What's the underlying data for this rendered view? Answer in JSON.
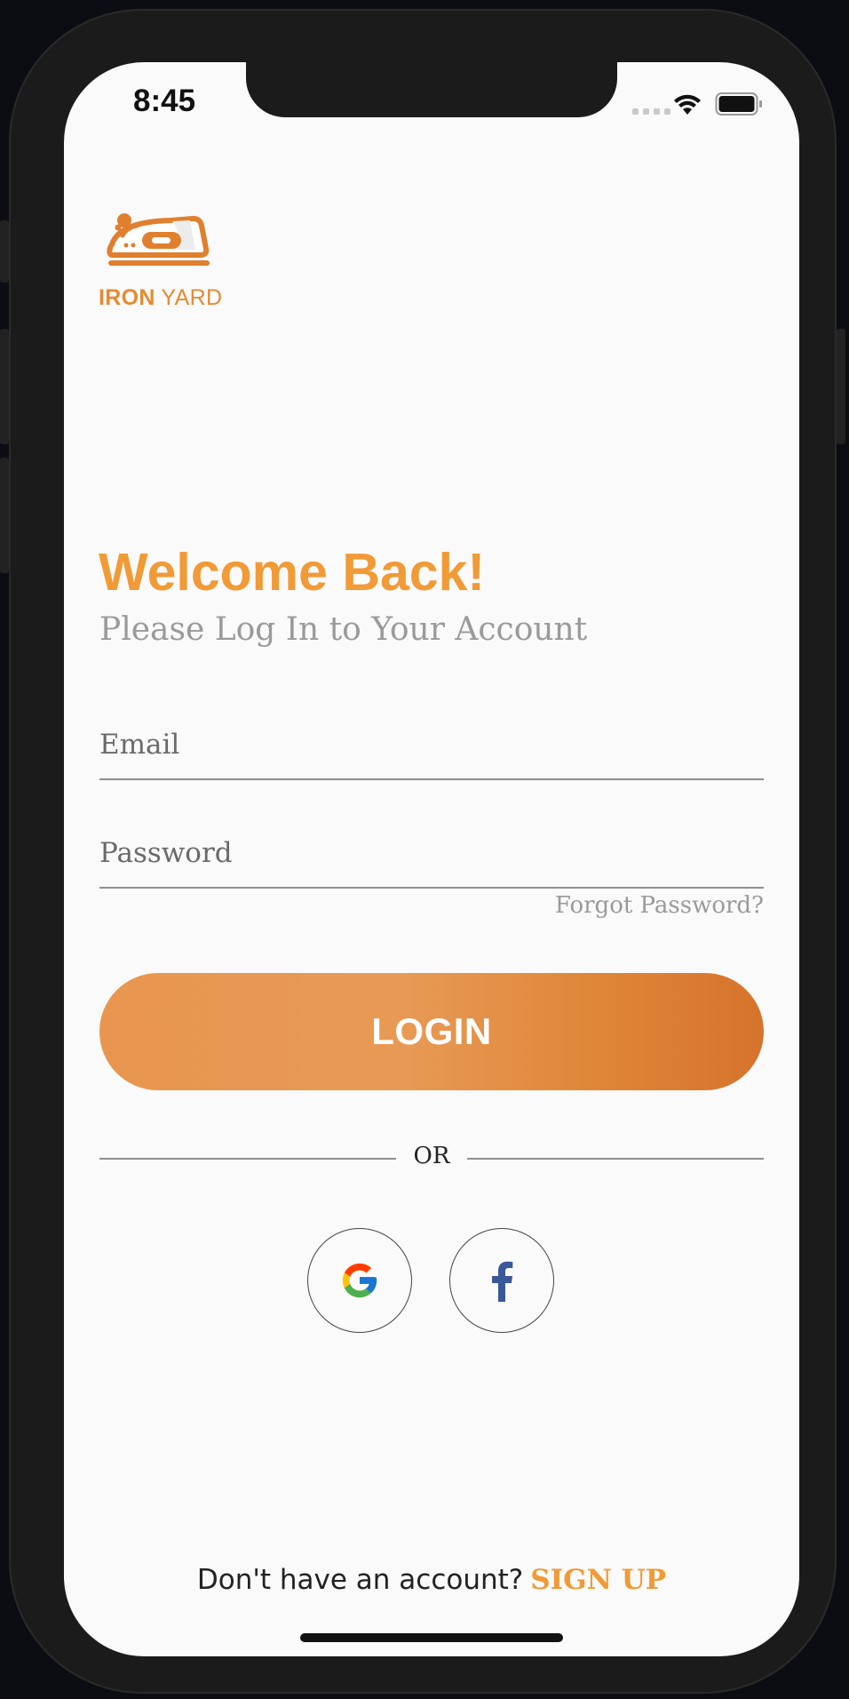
{
  "status_bar": {
    "time": "8:45"
  },
  "brand": {
    "name_bold": "IRON",
    "name_light": " YARD",
    "icon": "iron-icon",
    "color": "#e68a33"
  },
  "header": {
    "title": "Welcome Back!",
    "subtitle": "Please Log In to Your Account"
  },
  "form": {
    "email_placeholder": "Email",
    "password_placeholder": "Password",
    "forgot_label": "Forgot Password?",
    "login_label": "LOGIN"
  },
  "social": {
    "divider_label": "OR",
    "providers": [
      "google-icon",
      "facebook-icon"
    ]
  },
  "footer": {
    "prompt": "Don't have an account?",
    "signup_label": "SIGN UP"
  },
  "colors": {
    "accent": "#f19a36",
    "button_start": "#e8964f",
    "button_end": "#d6732c"
  }
}
